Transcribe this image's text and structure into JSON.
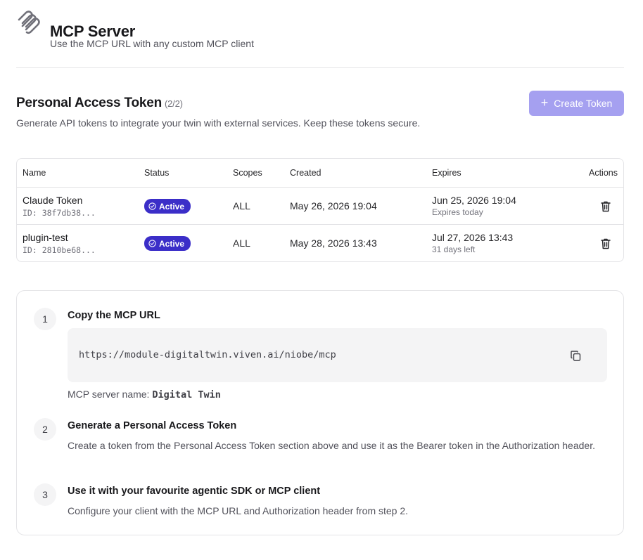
{
  "header": {
    "title": "MCP Server",
    "subtitle": "Use the MCP URL with any custom MCP client",
    "logo_icon": "paperclip-stack-icon"
  },
  "tokens_section": {
    "title": "Personal Access Token",
    "count": "(2/2)",
    "description": "Generate API tokens to integrate your twin with external services. Keep these tokens secure.",
    "create_button": {
      "icon": "plus-icon",
      "plus": "+",
      "label": "Create Token"
    }
  },
  "table": {
    "columns": [
      "Name",
      "Status",
      "Scopes",
      "Created",
      "Expires",
      "Actions"
    ],
    "rows": [
      {
        "name": "Claude Token",
        "id": "ID: 38f7db38...",
        "status": "Active",
        "scopes": "ALL",
        "created": "May 26, 2026 19:04",
        "expires": "Jun 25, 2026 19:04",
        "expires_note": "Expires today"
      },
      {
        "name": "plugin-test",
        "id": "ID: 2810be68...",
        "status": "Active",
        "scopes": "ALL",
        "created": "May 28, 2026 13:43",
        "expires": "Jul 27, 2026 13:43",
        "expires_note": "31 days left"
      }
    ]
  },
  "steps": [
    {
      "number": "1",
      "title": "Copy the MCP URL",
      "url": "https://module-digitaltwin.viven.ai/niobe/mcp",
      "server_name_label": "MCP server name:",
      "server_name_value": "Digital Twin"
    },
    {
      "number": "2",
      "title": "Generate a Personal Access Token",
      "description": "Create a token from the Personal Access Token section above and use it as the Bearer token in the Authorization header."
    },
    {
      "number": "3",
      "title": "Use it with your favourite agentic SDK or MCP client",
      "description": "Configure your client with the MCP URL and Authorization header from step 2."
    }
  ],
  "colors": {
    "accent": "#3b2ec8",
    "button_disabled": "#a5a0f0",
    "border": "#e4e4e7",
    "muted_bg": "#f4f4f5"
  }
}
